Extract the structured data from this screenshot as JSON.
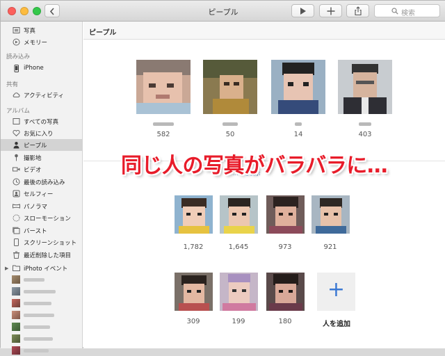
{
  "window": {
    "title": "ピープル",
    "search_placeholder": "検索"
  },
  "sidebar": {
    "top_items": [
      {
        "label": "写真",
        "icon": "photos-icon"
      },
      {
        "label": "メモリー",
        "icon": "memories-icon"
      }
    ],
    "section_import": "読み込み",
    "import_items": [
      {
        "label": "iPhone",
        "icon": "iphone-icon"
      }
    ],
    "section_shared": "共有",
    "shared_items": [
      {
        "label": "アクティビティ",
        "icon": "cloud-icon"
      }
    ],
    "section_albums": "アルバム",
    "album_items": [
      {
        "label": "すべての写真",
        "icon": "all-photos-icon"
      },
      {
        "label": "お気に入り",
        "icon": "heart-icon"
      },
      {
        "label": "ピープル",
        "icon": "person-icon",
        "selected": true
      },
      {
        "label": "撮影地",
        "icon": "pin-icon"
      },
      {
        "label": "ビデオ",
        "icon": "video-icon"
      },
      {
        "label": "最後の読み込み",
        "icon": "clock-icon"
      },
      {
        "label": "セルフィー",
        "icon": "selfie-icon"
      },
      {
        "label": "パノラマ",
        "icon": "panorama-icon"
      },
      {
        "label": "スローモーション",
        "icon": "slomo-icon"
      },
      {
        "label": "バースト",
        "icon": "burst-icon"
      },
      {
        "label": "スクリーンショット",
        "icon": "screenshot-icon"
      },
      {
        "label": "最近削除した項目",
        "icon": "trash-icon"
      }
    ],
    "iphoto_label": "iPhoto イベント"
  },
  "content": {
    "header": "ピープル",
    "favorites": [
      {
        "count": "582"
      },
      {
        "count": "50"
      },
      {
        "count": "14"
      },
      {
        "count": "403"
      }
    ],
    "show_more_text": "...みを表示",
    "row2": [
      {
        "count": "1,782"
      },
      {
        "count": "1,645"
      },
      {
        "count": "973"
      },
      {
        "count": "921"
      }
    ],
    "row3": [
      {
        "count": "309"
      },
      {
        "count": "199"
      },
      {
        "count": "180"
      }
    ],
    "add_person_label": "人を追加"
  },
  "overlay_caption": "同じ人の写真がバラバラに…",
  "colors": {
    "accent_blue": "#3a78d3",
    "caption_red": "#e81c2a",
    "sidebar_bg": "#f2f2f2",
    "sidebar_selected": "#d3d3d3"
  }
}
